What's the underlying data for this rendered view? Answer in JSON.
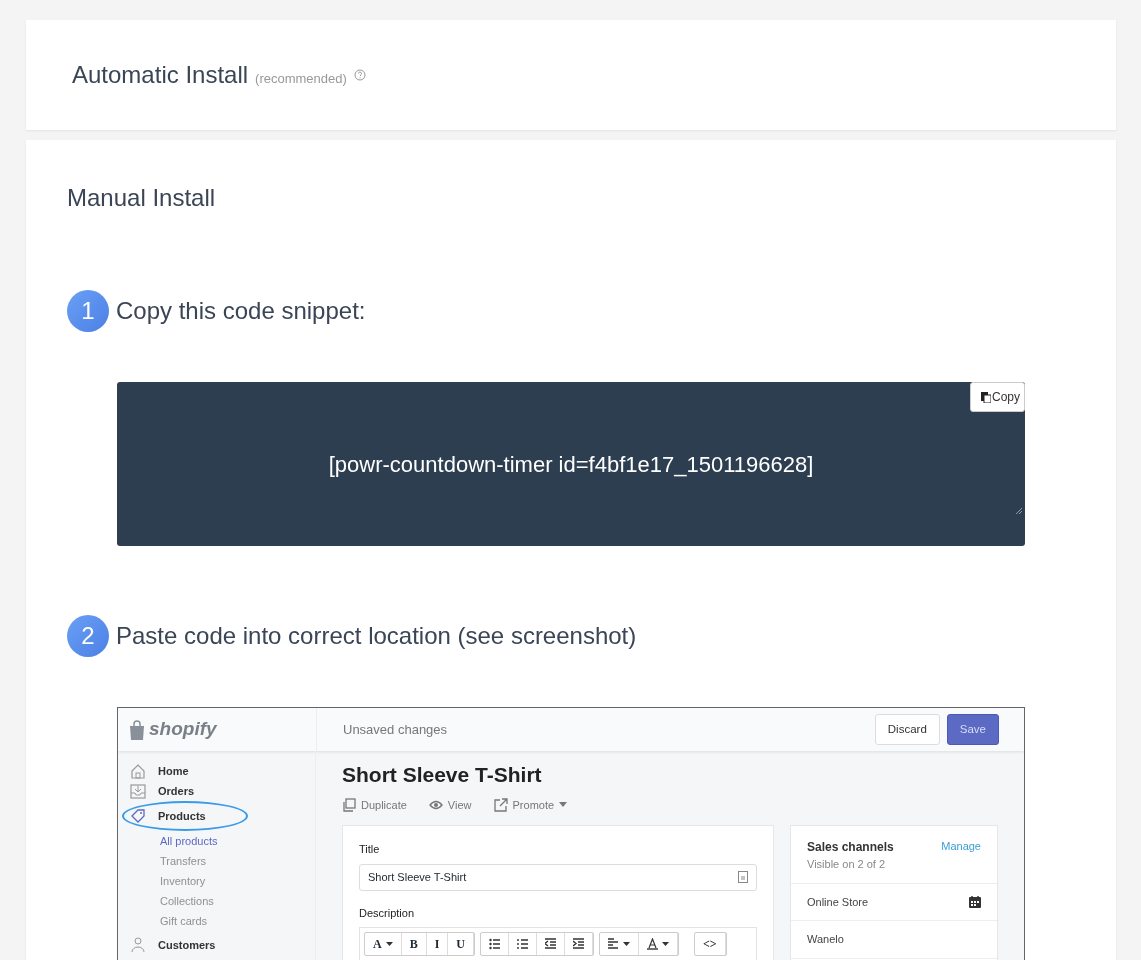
{
  "automatic_install": {
    "title": "Automatic Install",
    "note": "(recommended)"
  },
  "manual_install": {
    "title": "Manual Install",
    "steps": [
      {
        "number": "1",
        "text": "Copy this code snippet:"
      },
      {
        "number": "2",
        "text": "Paste code into correct location (see screenshot)"
      }
    ],
    "code_snippet": {
      "code": "[powr-countdown-timer id=f4bf1e17_1501196628]",
      "copy_button": "Copy"
    },
    "screenshot": {
      "logo": "shopify",
      "top_bar_title": "Unsaved changes",
      "buttons": [
        {
          "label": "Discard",
          "kind": "secondary"
        },
        {
          "label": "Save",
          "kind": "primary"
        }
      ],
      "nav": [
        {
          "label": "Home",
          "kind": "home",
          "circled": false
        },
        {
          "label": "Orders",
          "kind": "orders",
          "circled": false
        },
        {
          "label": "Products",
          "kind": "products",
          "circled": true,
          "children": [
            {
              "label": "All products",
              "selected": true
            },
            {
              "label": "Transfers",
              "selected": false
            },
            {
              "label": "Inventory",
              "selected": false
            },
            {
              "label": "Collections",
              "selected": false
            },
            {
              "label": "Gift cards",
              "selected": false
            }
          ]
        },
        {
          "label": "Customers",
          "kind": "customers",
          "circled": false
        }
      ],
      "page_title": "Short Sleeve T-Shirt",
      "actions": [
        {
          "label": "Duplicate",
          "kind": "duplicate",
          "dropdown": false
        },
        {
          "label": "View",
          "kind": "view",
          "dropdown": false
        },
        {
          "label": "Promote",
          "kind": "promote",
          "dropdown": true
        }
      ],
      "title_field": {
        "label": "Title",
        "value": "Short Sleeve T-Shirt"
      },
      "description_label": "Description",
      "toolbar": [
        [
          {
            "kind": "text",
            "label": "A",
            "dropdown": true
          },
          {
            "kind": "text",
            "label": "B",
            "dropdown": false
          },
          {
            "kind": "text",
            "label": "I",
            "dropdown": false
          },
          {
            "kind": "text",
            "label": "U",
            "dropdown": false
          }
        ],
        [
          {
            "kind": "bullets",
            "dropdown": false
          },
          {
            "kind": "numbers",
            "dropdown": false
          },
          {
            "kind": "outdent",
            "dropdown": false
          },
          {
            "kind": "indent",
            "dropdown": false
          }
        ],
        [
          {
            "kind": "align",
            "dropdown": true
          },
          {
            "kind": "color",
            "dropdown": true
          }
        ],
        [
          {
            "kind": "text",
            "label": "<>",
            "dropdown": false
          }
        ]
      ],
      "sales_channels": {
        "title": "Sales channels",
        "link": "Manage",
        "subtitle": "Visible on 2 of 2",
        "channels": [
          {
            "name": "Online Store",
            "scheduled": true
          },
          {
            "name": "Wanelo",
            "scheduled": false
          }
        ]
      }
    }
  }
}
